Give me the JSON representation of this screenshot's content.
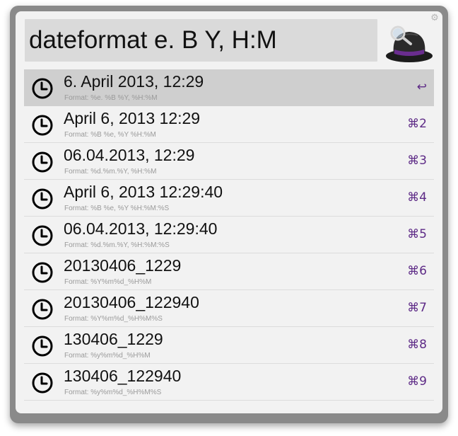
{
  "search": {
    "query": "dateformat e. B Y, H:M"
  },
  "header": {
    "settings_icon": "gear-icon",
    "logo_icon": "alfred-hat-logo-icon"
  },
  "colors": {
    "accent": "#5d2a86",
    "selected_row": "#cfcfcf",
    "background": "#f2f2f2"
  },
  "results": [
    {
      "title": "6. April 2013, 12:29",
      "subtitle": "Format: %e. %B %Y, %H:%M",
      "shortcut": "↩",
      "icon": "clock-icon",
      "selected": true
    },
    {
      "title": "April 6, 2013 12:29",
      "subtitle": "Format: %B %e, %Y  %H:%M",
      "shortcut": "⌘2",
      "icon": "clock-icon",
      "selected": false
    },
    {
      "title": "06.04.2013, 12:29",
      "subtitle": "Format: %d.%m.%Y, %H:%M",
      "shortcut": "⌘3",
      "icon": "clock-icon",
      "selected": false
    },
    {
      "title": "April 6, 2013 12:29:40",
      "subtitle": "Format: %B %e, %Y  %H:%M:%S",
      "shortcut": "⌘4",
      "icon": "clock-icon",
      "selected": false
    },
    {
      "title": "06.04.2013, 12:29:40",
      "subtitle": "Format: %d.%m.%Y, %H:%M:%S",
      "shortcut": "⌘5",
      "icon": "clock-icon",
      "selected": false
    },
    {
      "title": "20130406_1229",
      "subtitle": "Format: %Y%m%d_%H%M",
      "shortcut": "⌘6",
      "icon": "clock-icon",
      "selected": false
    },
    {
      "title": "20130406_122940",
      "subtitle": "Format: %Y%m%d_%H%M%S",
      "shortcut": "⌘7",
      "icon": "clock-icon",
      "selected": false
    },
    {
      "title": "130406_1229",
      "subtitle": "Format: %y%m%d_%H%M",
      "shortcut": "⌘8",
      "icon": "clock-icon",
      "selected": false
    },
    {
      "title": "130406_122940",
      "subtitle": "Format: %y%m%d_%H%M%S",
      "shortcut": "⌘9",
      "icon": "clock-icon",
      "selected": false
    }
  ]
}
